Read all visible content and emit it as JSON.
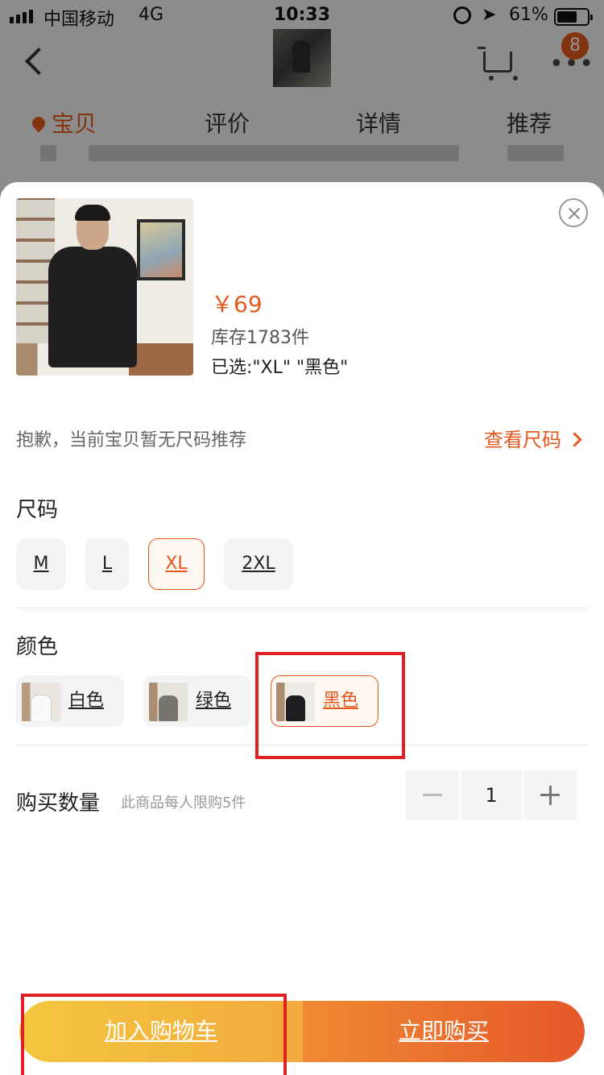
{
  "status_bar": {
    "carrier": "中国移动",
    "network": "4G",
    "time": "10:33",
    "battery": "61%"
  },
  "nav": {
    "badge_count": "8"
  },
  "tabs": [
    {
      "label": "宝贝",
      "active": true
    },
    {
      "label": "评价",
      "active": false
    },
    {
      "label": "详情",
      "active": false
    },
    {
      "label": "推荐",
      "active": false
    }
  ],
  "sku_panel": {
    "price": "￥69",
    "stock": "库存1783件",
    "selected": "已选:\"XL\" \"黑色\"",
    "size_tip": "抱歉，当前宝贝暂无尺码推荐",
    "size_link": "查看尺码",
    "size": {
      "title": "尺码",
      "options": [
        {
          "label": "M",
          "selected": false
        },
        {
          "label": "L",
          "selected": false
        },
        {
          "label": "XL",
          "selected": true
        },
        {
          "label": "2XL",
          "selected": false
        }
      ]
    },
    "color": {
      "title": "颜色",
      "options": [
        {
          "label": "白色",
          "selected": false
        },
        {
          "label": "绿色",
          "selected": false
        },
        {
          "label": "黑色",
          "selected": true
        }
      ]
    },
    "quantity": {
      "label": "购买数量",
      "limit_note": "此商品每人限购5件",
      "value": "1"
    },
    "buttons": {
      "add_to_cart": "加入购物车",
      "buy_now": "立即购买"
    }
  },
  "colors": {
    "accent": "#e4581d",
    "highlight_box": "#e01f26"
  }
}
